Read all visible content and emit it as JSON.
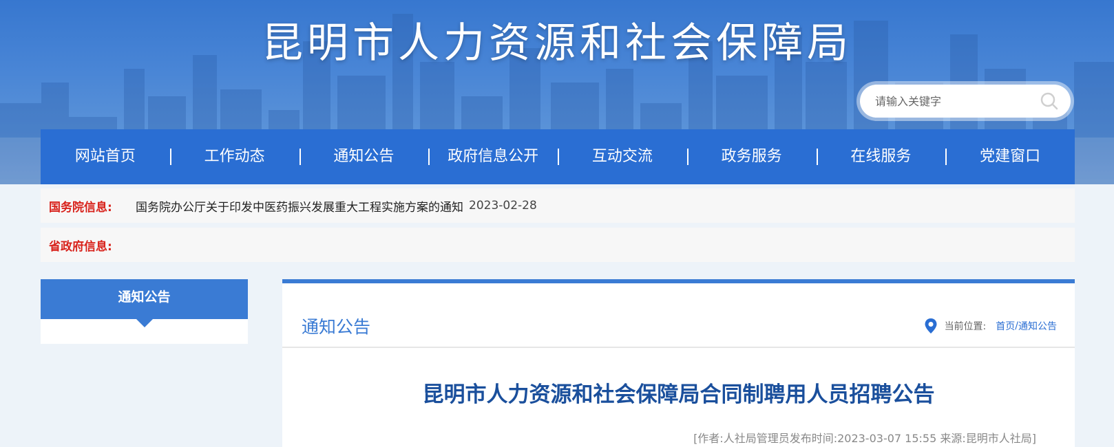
{
  "header": {
    "site_title": "昆明市人力资源和社会保障局",
    "search_placeholder": "请输入关键字"
  },
  "nav": {
    "items": [
      {
        "label": "网站首页"
      },
      {
        "label": "工作动态"
      },
      {
        "label": "通知公告"
      },
      {
        "label": "政府信息公开"
      },
      {
        "label": "互动交流"
      },
      {
        "label": "政务服务"
      },
      {
        "label": "在线服务"
      },
      {
        "label": "党建窗口"
      }
    ]
  },
  "info": {
    "state_council": {
      "label": "国务院信息:",
      "link_text": "国务院办公厅关于印发中医药振兴发展重大工程实施方案的通知",
      "date": "2023-02-28"
    },
    "province": {
      "label": "省政府信息:"
    }
  },
  "sidebar": {
    "title": "通知公告"
  },
  "main": {
    "section_title": "通知公告",
    "location_label": "当前位置:",
    "breadcrumb": {
      "home": "首页",
      "separator": "/",
      "current": "通知公告"
    },
    "article": {
      "title": "昆明市人力资源和社会保障局合同制聘用人员招聘公告",
      "meta": "[作者:人社局管理员发布时间:2023-03-07 15:55 来源:昆明市人社局]"
    }
  },
  "colors": {
    "nav_bg": "#2a6ed3",
    "accent": "#3a7bd4",
    "label_red": "#d8231c",
    "article_title": "#1a4f9c"
  }
}
